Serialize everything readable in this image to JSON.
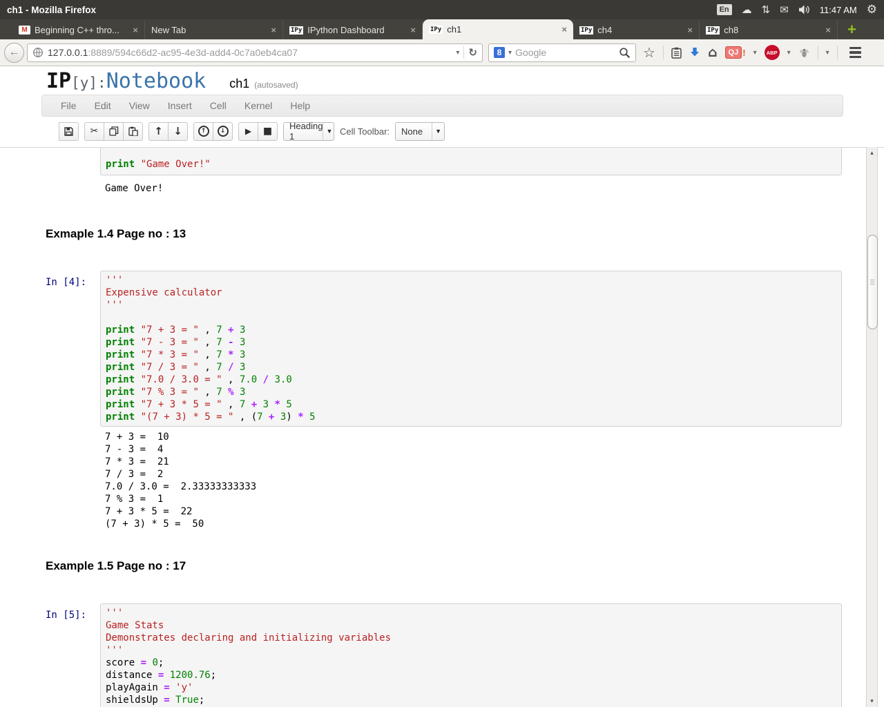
{
  "desktop": {
    "window_title": "ch1 - Mozilla Firefox",
    "keyboard_indicator": "En",
    "clock": "11:47 AM"
  },
  "icons": {
    "cloud": "☁",
    "sync": "⇅",
    "mail": "✉",
    "gear": "⚙",
    "back": "←",
    "reload": "↻",
    "caret": "▾",
    "star": "☆",
    "home": "⌂",
    "cut": "✂",
    "arrow_up": "↑",
    "arrow_down": "↓",
    "run": "▶",
    "stop": "■",
    "scroll_up": "▴",
    "scroll_down": "▾",
    "close": "×",
    "plus": "+",
    "gmail": "M"
  },
  "browser": {
    "tabs": [
      {
        "label": "Beginning C++ thro...",
        "icon": "gmail",
        "active": false
      },
      {
        "label": "New Tab",
        "icon": "",
        "active": false
      },
      {
        "label": "IPython Dashboard",
        "icon": "ipy",
        "active": false
      },
      {
        "label": "ch1",
        "icon": "ipy",
        "active": true
      },
      {
        "label": "ch4",
        "icon": "ipy",
        "active": false
      },
      {
        "label": "ch8",
        "icon": "ipy",
        "active": false
      }
    ],
    "ipy_favicon_text": "IPy",
    "url_host": "127.0.0.1",
    "url_rest": ":8889/594c66d2-ac95-4e3d-add4-0c7a0eb4ca07",
    "search_placeholder": "Google",
    "google_logo_glyph": "8",
    "quickjava_label": "QJ",
    "quickjava_bang": "!",
    "adblock_label": "ABP"
  },
  "notebook": {
    "logo_ip": "IP",
    "logo_y": "[y]:",
    "logo_name": "Notebook",
    "title": "ch1",
    "autosave": "(autosaved)",
    "menu": [
      "File",
      "Edit",
      "View",
      "Insert",
      "Cell",
      "Kernel",
      "Help"
    ],
    "toolbar": {
      "groups": [
        [
          "save"
        ],
        [
          "cut",
          "copy",
          "paste"
        ],
        [
          "move-up",
          "move-down"
        ],
        [
          "insert-above",
          "insert-below"
        ],
        [
          "run",
          "stop"
        ]
      ],
      "cell_type_value": "Heading 1",
      "cell_toolbar_label": "Cell Toolbar:",
      "cell_toolbar_value": "None"
    },
    "colors": {
      "keyword": "#008000",
      "string": "#BA2121",
      "number": "#008000",
      "operator": "#AA22FF",
      "prompt": "#000080"
    },
    "cells": [
      {
        "type": "code",
        "cut_top": true,
        "prompt": "",
        "lines": [
          [
            {
              "c": "kw",
              "v": "print"
            },
            {
              "c": "pl",
              "v": " "
            },
            {
              "c": "str",
              "v": "\"Game Over!\""
            }
          ]
        ],
        "output": [
          "Game Over!"
        ]
      },
      {
        "type": "heading",
        "text": "Exmaple 1.4 Page no : 13"
      },
      {
        "type": "code",
        "cut_top": false,
        "prompt": "In [4]:",
        "lines": [
          [
            {
              "c": "str",
              "v": "'''"
            }
          ],
          [
            {
              "c": "str",
              "v": "Expensive calculator"
            }
          ],
          [
            {
              "c": "str",
              "v": "'''"
            }
          ],
          [],
          [
            {
              "c": "kw",
              "v": "print"
            },
            {
              "c": "pl",
              "v": " "
            },
            {
              "c": "str",
              "v": "\"7 + 3 = \""
            },
            {
              "c": "pl",
              "v": " , "
            },
            {
              "c": "num",
              "v": "7"
            },
            {
              "c": "pl",
              "v": " "
            },
            {
              "c": "op",
              "v": "+"
            },
            {
              "c": "pl",
              "v": " "
            },
            {
              "c": "num",
              "v": "3"
            }
          ],
          [
            {
              "c": "kw",
              "v": "print"
            },
            {
              "c": "pl",
              "v": " "
            },
            {
              "c": "str",
              "v": "\"7 - 3 = \""
            },
            {
              "c": "pl",
              "v": " , "
            },
            {
              "c": "num",
              "v": "7"
            },
            {
              "c": "pl",
              "v": " "
            },
            {
              "c": "op",
              "v": "-"
            },
            {
              "c": "pl",
              "v": " "
            },
            {
              "c": "num",
              "v": "3"
            }
          ],
          [
            {
              "c": "kw",
              "v": "print"
            },
            {
              "c": "pl",
              "v": " "
            },
            {
              "c": "str",
              "v": "\"7 * 3 = \""
            },
            {
              "c": "pl",
              "v": " , "
            },
            {
              "c": "num",
              "v": "7"
            },
            {
              "c": "pl",
              "v": " "
            },
            {
              "c": "op",
              "v": "*"
            },
            {
              "c": "pl",
              "v": " "
            },
            {
              "c": "num",
              "v": "3"
            }
          ],
          [
            {
              "c": "kw",
              "v": "print"
            },
            {
              "c": "pl",
              "v": " "
            },
            {
              "c": "str",
              "v": "\"7 / 3 = \""
            },
            {
              "c": "pl",
              "v": " , "
            },
            {
              "c": "num",
              "v": "7"
            },
            {
              "c": "pl",
              "v": " "
            },
            {
              "c": "op",
              "v": "/"
            },
            {
              "c": "pl",
              "v": " "
            },
            {
              "c": "num",
              "v": "3"
            }
          ],
          [
            {
              "c": "kw",
              "v": "print"
            },
            {
              "c": "pl",
              "v": " "
            },
            {
              "c": "str",
              "v": "\"7.0 / 3.0 = \""
            },
            {
              "c": "pl",
              "v": " , "
            },
            {
              "c": "num",
              "v": "7.0"
            },
            {
              "c": "pl",
              "v": " "
            },
            {
              "c": "op",
              "v": "/"
            },
            {
              "c": "pl",
              "v": " "
            },
            {
              "c": "num",
              "v": "3.0"
            }
          ],
          [
            {
              "c": "kw",
              "v": "print"
            },
            {
              "c": "pl",
              "v": " "
            },
            {
              "c": "str",
              "v": "\"7 % 3 = \""
            },
            {
              "c": "pl",
              "v": " , "
            },
            {
              "c": "num",
              "v": "7"
            },
            {
              "c": "pl",
              "v": " "
            },
            {
              "c": "op",
              "v": "%"
            },
            {
              "c": "pl",
              "v": " "
            },
            {
              "c": "num",
              "v": "3"
            }
          ],
          [
            {
              "c": "kw",
              "v": "print"
            },
            {
              "c": "pl",
              "v": " "
            },
            {
              "c": "str",
              "v": "\"7 + 3 * 5 = \""
            },
            {
              "c": "pl",
              "v": " , "
            },
            {
              "c": "num",
              "v": "7"
            },
            {
              "c": "pl",
              "v": " "
            },
            {
              "c": "op",
              "v": "+"
            },
            {
              "c": "pl",
              "v": " "
            },
            {
              "c": "num",
              "v": "3"
            },
            {
              "c": "pl",
              "v": " "
            },
            {
              "c": "op",
              "v": "*"
            },
            {
              "c": "pl",
              "v": " "
            },
            {
              "c": "num",
              "v": "5"
            }
          ],
          [
            {
              "c": "kw",
              "v": "print"
            },
            {
              "c": "pl",
              "v": " "
            },
            {
              "c": "str",
              "v": "\"(7 + 3) * 5 = \""
            },
            {
              "c": "pl",
              "v": " , ("
            },
            {
              "c": "num",
              "v": "7"
            },
            {
              "c": "pl",
              "v": " "
            },
            {
              "c": "op",
              "v": "+"
            },
            {
              "c": "pl",
              "v": " "
            },
            {
              "c": "num",
              "v": "3"
            },
            {
              "c": "pl",
              "v": ") "
            },
            {
              "c": "op",
              "v": "*"
            },
            {
              "c": "pl",
              "v": " "
            },
            {
              "c": "num",
              "v": "5"
            }
          ]
        ],
        "output": [
          "7 + 3 =  10",
          "7 - 3 =  4",
          "7 * 3 =  21",
          "7 / 3 =  2",
          "7.0 / 3.0 =  2.33333333333",
          "7 % 3 =  1",
          "7 + 3 * 5 =  22",
          "(7 + 3) * 5 =  50"
        ]
      },
      {
        "type": "heading",
        "text": "Example 1.5 Page no : 17"
      },
      {
        "type": "code",
        "cut_top": false,
        "prompt": "In [5]:",
        "lines": [
          [
            {
              "c": "str",
              "v": "'''"
            }
          ],
          [
            {
              "c": "str",
              "v": "Game Stats"
            }
          ],
          [
            {
              "c": "str",
              "v": "Demonstrates declaring and initializing variables"
            }
          ],
          [
            {
              "c": "str",
              "v": "'''"
            }
          ],
          [
            {
              "c": "pl",
              "v": "score "
            },
            {
              "c": "op",
              "v": "="
            },
            {
              "c": "pl",
              "v": " "
            },
            {
              "c": "num",
              "v": "0"
            },
            {
              "c": "pl",
              "v": ";"
            }
          ],
          [
            {
              "c": "pl",
              "v": "distance "
            },
            {
              "c": "op",
              "v": "="
            },
            {
              "c": "pl",
              "v": " "
            },
            {
              "c": "num",
              "v": "1200.76"
            },
            {
              "c": "pl",
              "v": ";"
            }
          ],
          [
            {
              "c": "pl",
              "v": "playAgain "
            },
            {
              "c": "op",
              "v": "="
            },
            {
              "c": "pl",
              "v": " "
            },
            {
              "c": "str",
              "v": "'y'"
            }
          ],
          [
            {
              "c": "pl",
              "v": "shieldsUp "
            },
            {
              "c": "op",
              "v": "="
            },
            {
              "c": "pl",
              "v": " "
            },
            {
              "c": "num",
              "v": "True"
            },
            {
              "c": "pl",
              "v": ";"
            }
          ]
        ],
        "output": []
      }
    ]
  }
}
